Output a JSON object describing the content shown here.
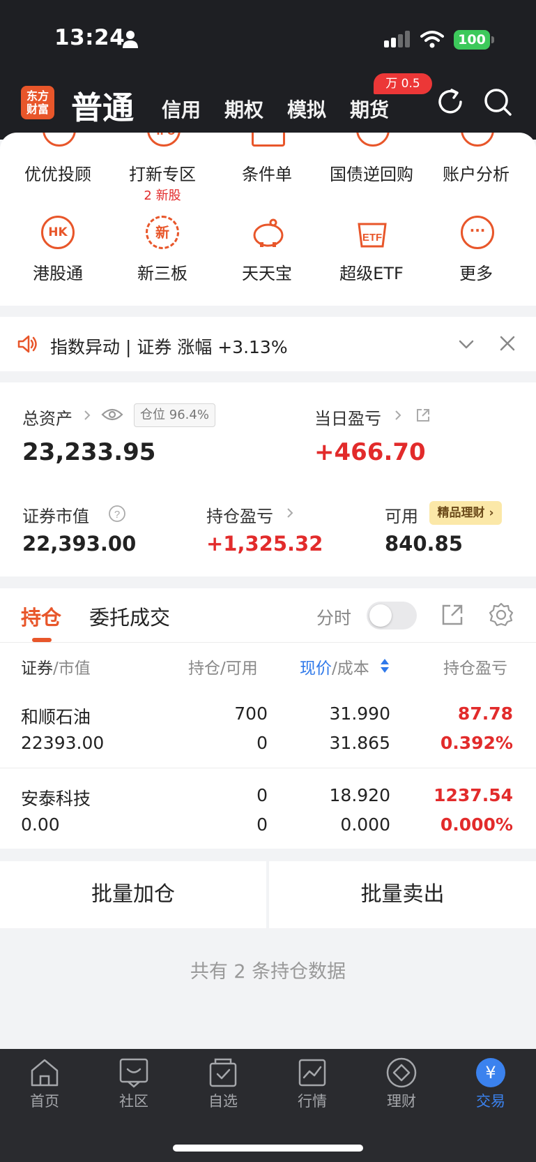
{
  "status_bar": {
    "time": "13:24",
    "battery": "100"
  },
  "header": {
    "logo": "东方财富",
    "active_tab": "普通",
    "tabs": [
      "信用",
      "期权",
      "模拟",
      "期货"
    ]
  },
  "quick_menu": {
    "row1": [
      {
        "label": "优优投顾",
        "sub": ""
      },
      {
        "label": "打新专区",
        "sub": "2 新股"
      },
      {
        "label": "条件单",
        "sub": ""
      },
      {
        "label": "国债逆回购",
        "sub": ""
      },
      {
        "label": "账户分析",
        "sub": ""
      }
    ],
    "row2": [
      {
        "label": "港股通",
        "icon_text": "HK"
      },
      {
        "label": "新三板",
        "icon_text": "新"
      },
      {
        "label": "天天宝",
        "icon_text": ""
      },
      {
        "label": "超级ETF",
        "icon_text": "ETF"
      },
      {
        "label": "更多",
        "icon_text": "···"
      }
    ],
    "badge": "万 0.5",
    "ipo_icon_text": "IPO"
  },
  "notice": {
    "text": "指数异动 | 证券 涨幅 +3.13%"
  },
  "assets": {
    "total_label": "总资产",
    "position_ratio": "仓位 96.4%",
    "total_value": "23,233.95",
    "daily_pl_label": "当日盈亏",
    "daily_pl_value": "+466.70",
    "market_value_label": "证券市值",
    "market_value": "22,393.00",
    "holding_pl_label": "持仓盈亏",
    "holding_pl_value": "+1,325.32",
    "available_label": "可用",
    "premium_label": "精品理财",
    "available_value": "840.85"
  },
  "holdings": {
    "tab_active": "持仓",
    "tab_other": "委托成交",
    "fenshi": "分时",
    "columns": {
      "c1a": "证券",
      "c1b": "/市值",
      "c2": "持仓/可用",
      "c3a": "现价",
      "c3b": "/成本",
      "c4": "持仓盈亏"
    },
    "rows": [
      {
        "name": "和顺石油",
        "market_value": "22393.00",
        "qty": "700",
        "avail": "0",
        "price": "31.990",
        "cost": "31.865",
        "pl": "87.78",
        "pl_pct": "0.392%"
      },
      {
        "name": "安泰科技",
        "market_value": "0.00",
        "qty": "0",
        "avail": "0",
        "price": "18.920",
        "cost": "0.000",
        "pl": "1237.54",
        "pl_pct": "0.000%"
      }
    ]
  },
  "batch": {
    "add": "批量加仓",
    "sell": "批量卖出"
  },
  "footer": {
    "summary": "共有 2 条持仓数据"
  },
  "bottom_nav": [
    {
      "label": "首页",
      "icon": "home-icon"
    },
    {
      "label": "社区",
      "icon": "chat-icon"
    },
    {
      "label": "自选",
      "icon": "watchlist-icon"
    },
    {
      "label": "行情",
      "icon": "chart-icon"
    },
    {
      "label": "理财",
      "icon": "diamond-icon"
    },
    {
      "label": "交易",
      "icon": "yen-icon"
    }
  ],
  "colors": {
    "brand": "#e8562a",
    "red": "#e22b2b",
    "blue": "#3b82ee",
    "header_bg": "#1e1f23"
  }
}
